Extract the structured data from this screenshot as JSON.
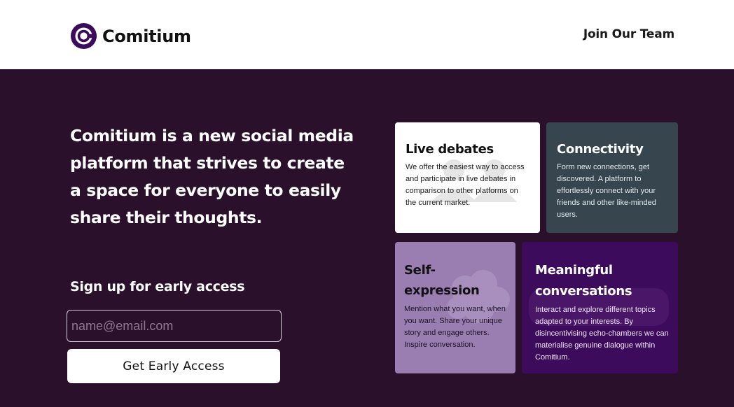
{
  "header": {
    "brand": "Comitium",
    "logo_icon": "comitium-logo-icon",
    "nav_link": "Join Our Team"
  },
  "hero": {
    "text": "Comitium is a new social media platform that strives to create a space for everyone to easily share their thoughts."
  },
  "signup": {
    "title": "Sign up for early access",
    "email_placeholder": "name@email.com",
    "email_value": "",
    "button_label": "Get Early Access"
  },
  "features": {
    "debates": {
      "title": "Live debates",
      "text": "We offer the easiest way to access and participate in live debates in comparison to other platforms on the current market.",
      "icon": "people-icon"
    },
    "connect": {
      "title": "Connectivity",
      "text": "Form new connections, get discovered. A platform to effortlessly connect with your friends and other like-minded users."
    },
    "self": {
      "title": "Self-expression",
      "text": "Mention what you want, when you want. Share your unique story and engage others. Inspire conversation.",
      "icon": "thought-cloud-icon"
    },
    "convo": {
      "title": "Meaningful conversations",
      "text": "Interact and explore different topics adapted to your interests. By disincentivising echo-chambers we can materialise genuine dialogue within Comitium.",
      "icon": "chat-bubble-icon"
    }
  },
  "colors": {
    "page_background": "#2a102b",
    "header_background": "#ffffff",
    "brand_purple": "#3d0b5b",
    "connectivity_card": "#37454f",
    "self_expression_card": "#9a7db1"
  }
}
